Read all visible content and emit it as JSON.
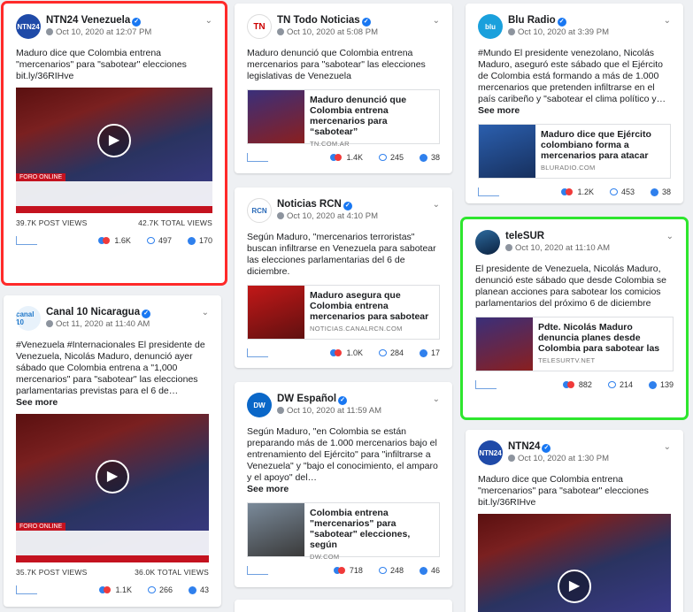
{
  "posts": {
    "ntn24ve": {
      "name": "NTN24 Venezuela",
      "date": "Oct 10, 2020 at 12:07 PM",
      "text": "Maduro dice que Colombia entrena \"mercenarios\" para \"sabotear\" elecciones bit.ly/36RIHve",
      "post_views": "39.7K POST VIEWS",
      "total_views": "42.7K TOTAL VIEWS",
      "reactions": "1.6K",
      "comments": "497",
      "shares": "170",
      "video_caption": "FORO ONLINE"
    },
    "canal10": {
      "name": "Canal 10 Nicaragua",
      "date": "Oct 11, 2020 at 11:40 AM",
      "text": "#Venezuela #Internacionales El presidente de Venezuela, Nicolás Maduro, denunció ayer sábado que Colombia entrena a \"1,000 mercenarios\" para \"sabotear\" las elecciones parlamentarias previstas para el 6 de…",
      "see_more": "See more",
      "post_views": "35.7K POST VIEWS",
      "total_views": "36.0K TOTAL VIEWS",
      "reactions": "1.1K",
      "comments": "266",
      "shares": "43",
      "video_caption": "FORO ONLINE"
    },
    "tn": {
      "name": "TN Todo Noticias",
      "date": "Oct 10, 2020 at 5:08 PM",
      "text": "Maduro denunció que Colombia entrena mercenarios para \"sabotear\" las elecciones legislativas de Venezuela",
      "link_title": "Maduro denunció que Colombia entrena mercenarios para “sabotear”",
      "link_domain": "TN.COM.AR",
      "reactions": "1.4K",
      "comments": "245",
      "shares": "38"
    },
    "rcn": {
      "name": "Noticias RCN",
      "date": "Oct 10, 2020 at 4:10 PM",
      "text": "Según Maduro, \"mercenarios terroristas\" buscan infiltrarse en Venezuela para sabotear las elecciones parlamentarias del 6 de diciembre.",
      "link_title": "Maduro asegura que Colombia entrena mercenarios para sabotear",
      "link_domain": "NOTICIAS.CANALRCN.COM",
      "reactions": "1.0K",
      "comments": "284",
      "shares": "17"
    },
    "dw": {
      "name": "DW Español",
      "date": "Oct 10, 2020 at 11:59 AM",
      "text": "Según Maduro, \"en Colombia se están preparando más de 1.000 mercenarios bajo el entrenamiento del Ejército\" para \"infiltrarse a Venezuela\" y \"bajo el conocimiento, el amparo y el apoyo\" del…",
      "see_more": "See more",
      "link_title": "Colombia entrena \"mercenarios\" para \"sabotear\" elecciones, según",
      "link_domain": "DW.COM",
      "reactions": "718",
      "comments": "248",
      "shares": "46"
    },
    "blu": {
      "name": "Blu Radio",
      "date": "Oct 10, 2020 at 3:39 PM",
      "text": "#Mundo El presidente venezolano, Nicolás Maduro, aseguró este sábado que el Ejército de Colombia está formando a más de 1.000 mercenarios que pretenden infiltrarse en el país caribeño y \"sabotear el clima político y…",
      "see_more": "See more",
      "link_title": "Maduro dice que Ejército colombiano forma a mercenarios para atacar",
      "link_domain": "BLURADIO.COM",
      "reactions": "1.2K",
      "comments": "453",
      "shares": "38"
    },
    "telesur": {
      "name": "teleSUR",
      "date": "Oct 10, 2020 at 11:10 AM",
      "text": "El presidente de Venezuela, Nicolás Maduro, denunció este sábado que desde Colombia se planean acciones para sabotear los comicios parlamentarios del próximo 6 de diciembre",
      "link_title": "Pdte. Nicolás Maduro denuncia planes desde Colombia para sabotear las",
      "link_domain": "TELESURTV.NET",
      "reactions": "882",
      "comments": "214",
      "shares": "139"
    },
    "ntn24": {
      "name": "NTN24",
      "date": "Oct 10, 2020 at 1:30 PM",
      "text": "Maduro dice que Colombia entrena \"mercenarios\" para \"sabotear\" elecciones bit.ly/36RIHve"
    }
  },
  "avatars": {
    "ntn24ve": "NTN24",
    "canal10": "canal 10",
    "tn": "TN",
    "rcn": "RCN",
    "dw": "DW",
    "blu": "blu",
    "telesur": "",
    "ntn24": "NTN24"
  },
  "colors": {
    "highlight_red": "#ff2a2a",
    "highlight_green": "#2ee62e",
    "verified": "#1877f2"
  },
  "icons": {
    "play": "▶",
    "chevron": "⌄",
    "check": "✓"
  }
}
